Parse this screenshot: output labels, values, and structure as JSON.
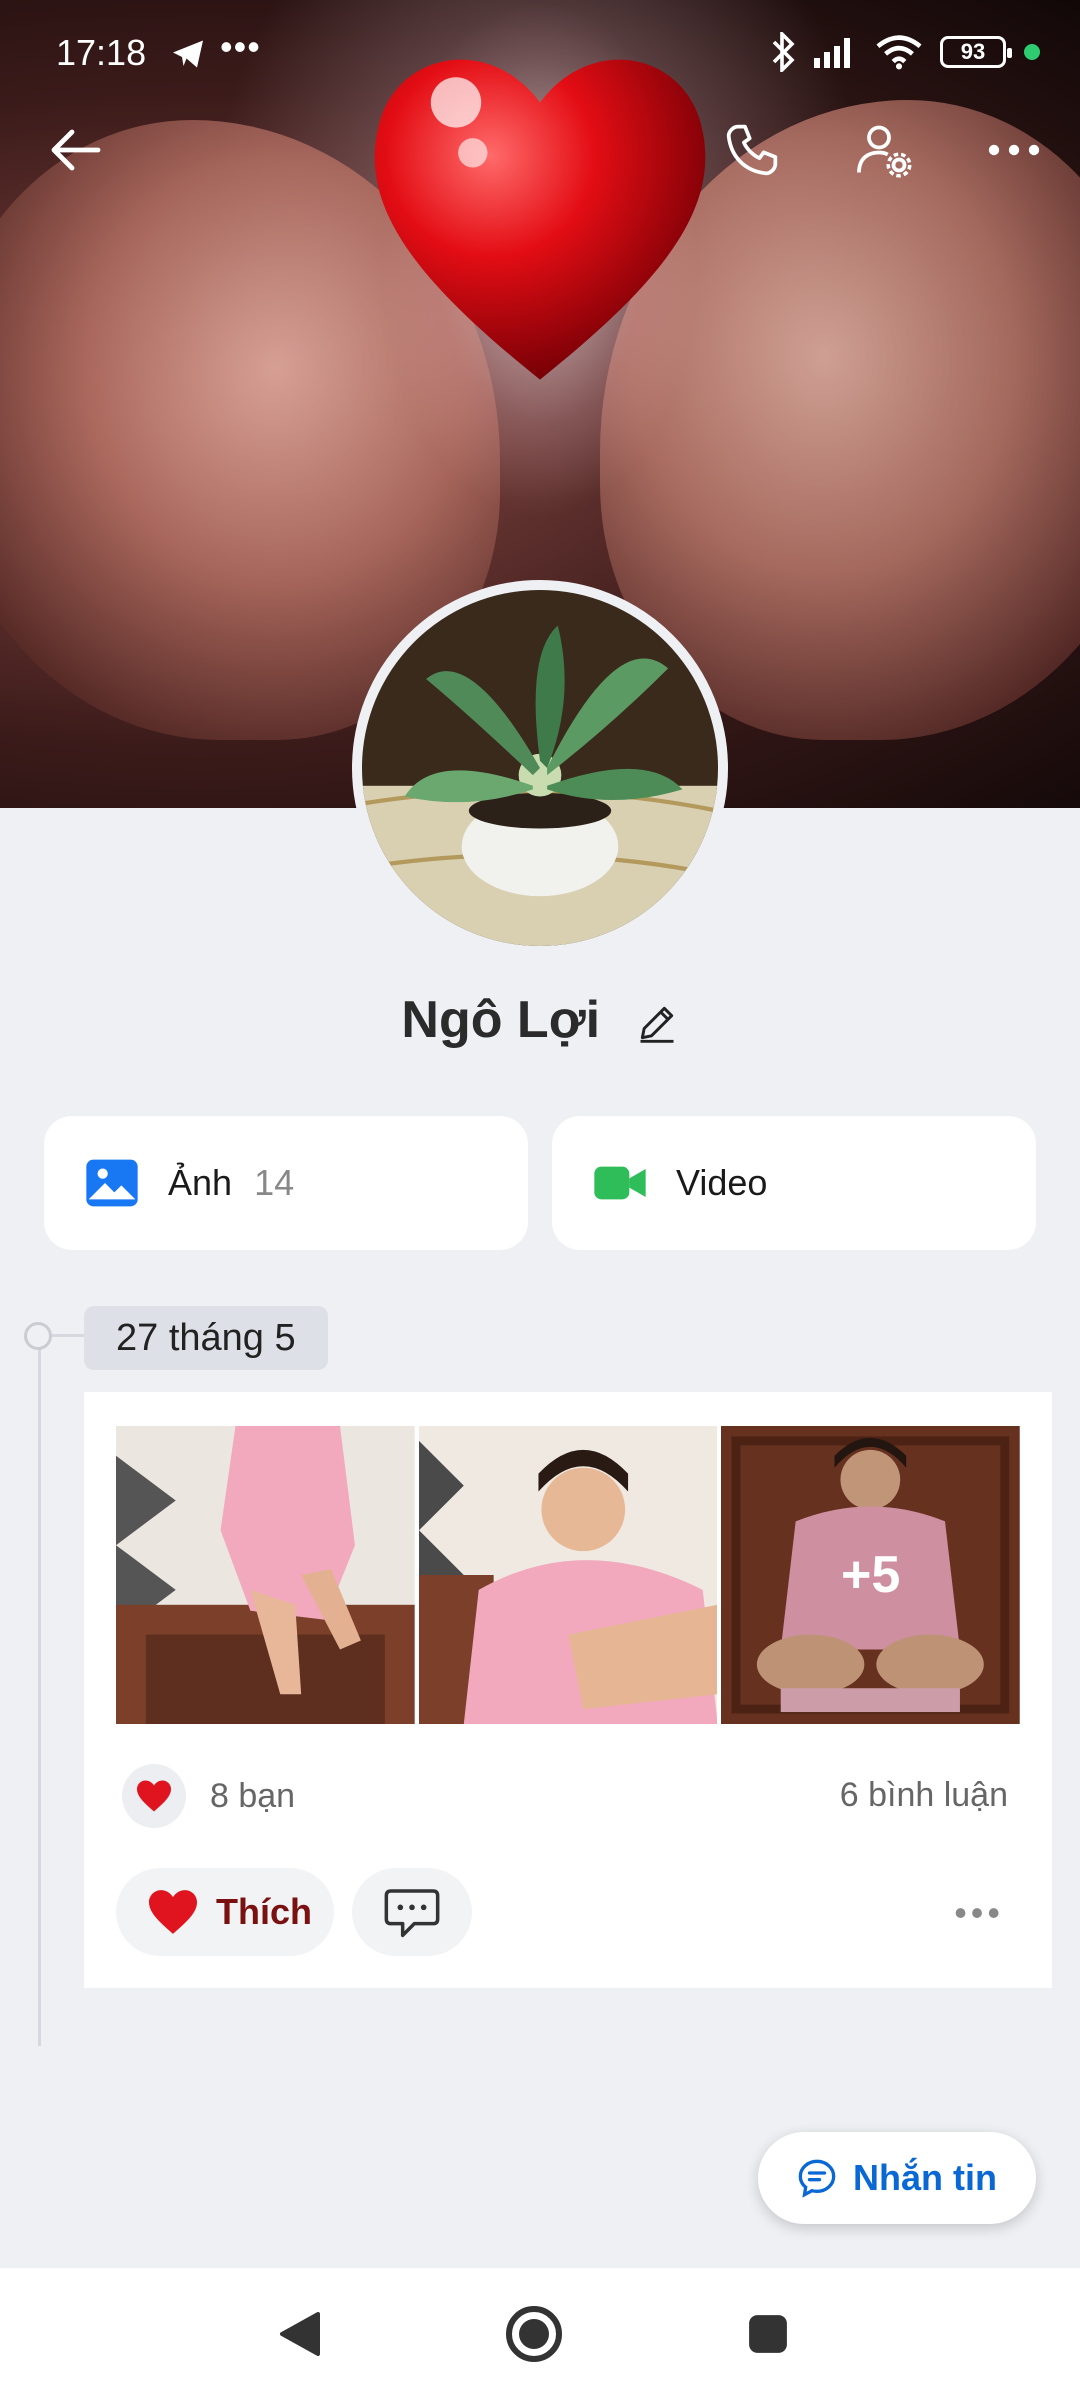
{
  "status_bar": {
    "time": "17:18",
    "battery": "93",
    "icons": [
      "telegram-icon",
      "more-dots-icon",
      "bluetooth-icon",
      "signal-icon",
      "wifi-icon",
      "battery-icon"
    ]
  },
  "topbar": {
    "icons": [
      "back-arrow-icon",
      "phone-call-icon",
      "user-settings-icon",
      "more-horizontal-icon"
    ]
  },
  "profile": {
    "name": "Ngô Lợi"
  },
  "media": {
    "photos_label": "Ảnh",
    "photos_count": "14",
    "video_label": "Video"
  },
  "timeline": {
    "date": "27 tháng 5",
    "post": {
      "extra_photos": "+5",
      "reactions": "8 bạn",
      "comments": "6 bình luận",
      "like_label": "Thích"
    }
  },
  "message_button": {
    "label": "Nhắn tin"
  },
  "colors": {
    "accent": "#0a68d4",
    "background": "#eef0f4",
    "like": "#e0141e",
    "video": "#2ebd59",
    "photo": "#1877f2"
  }
}
